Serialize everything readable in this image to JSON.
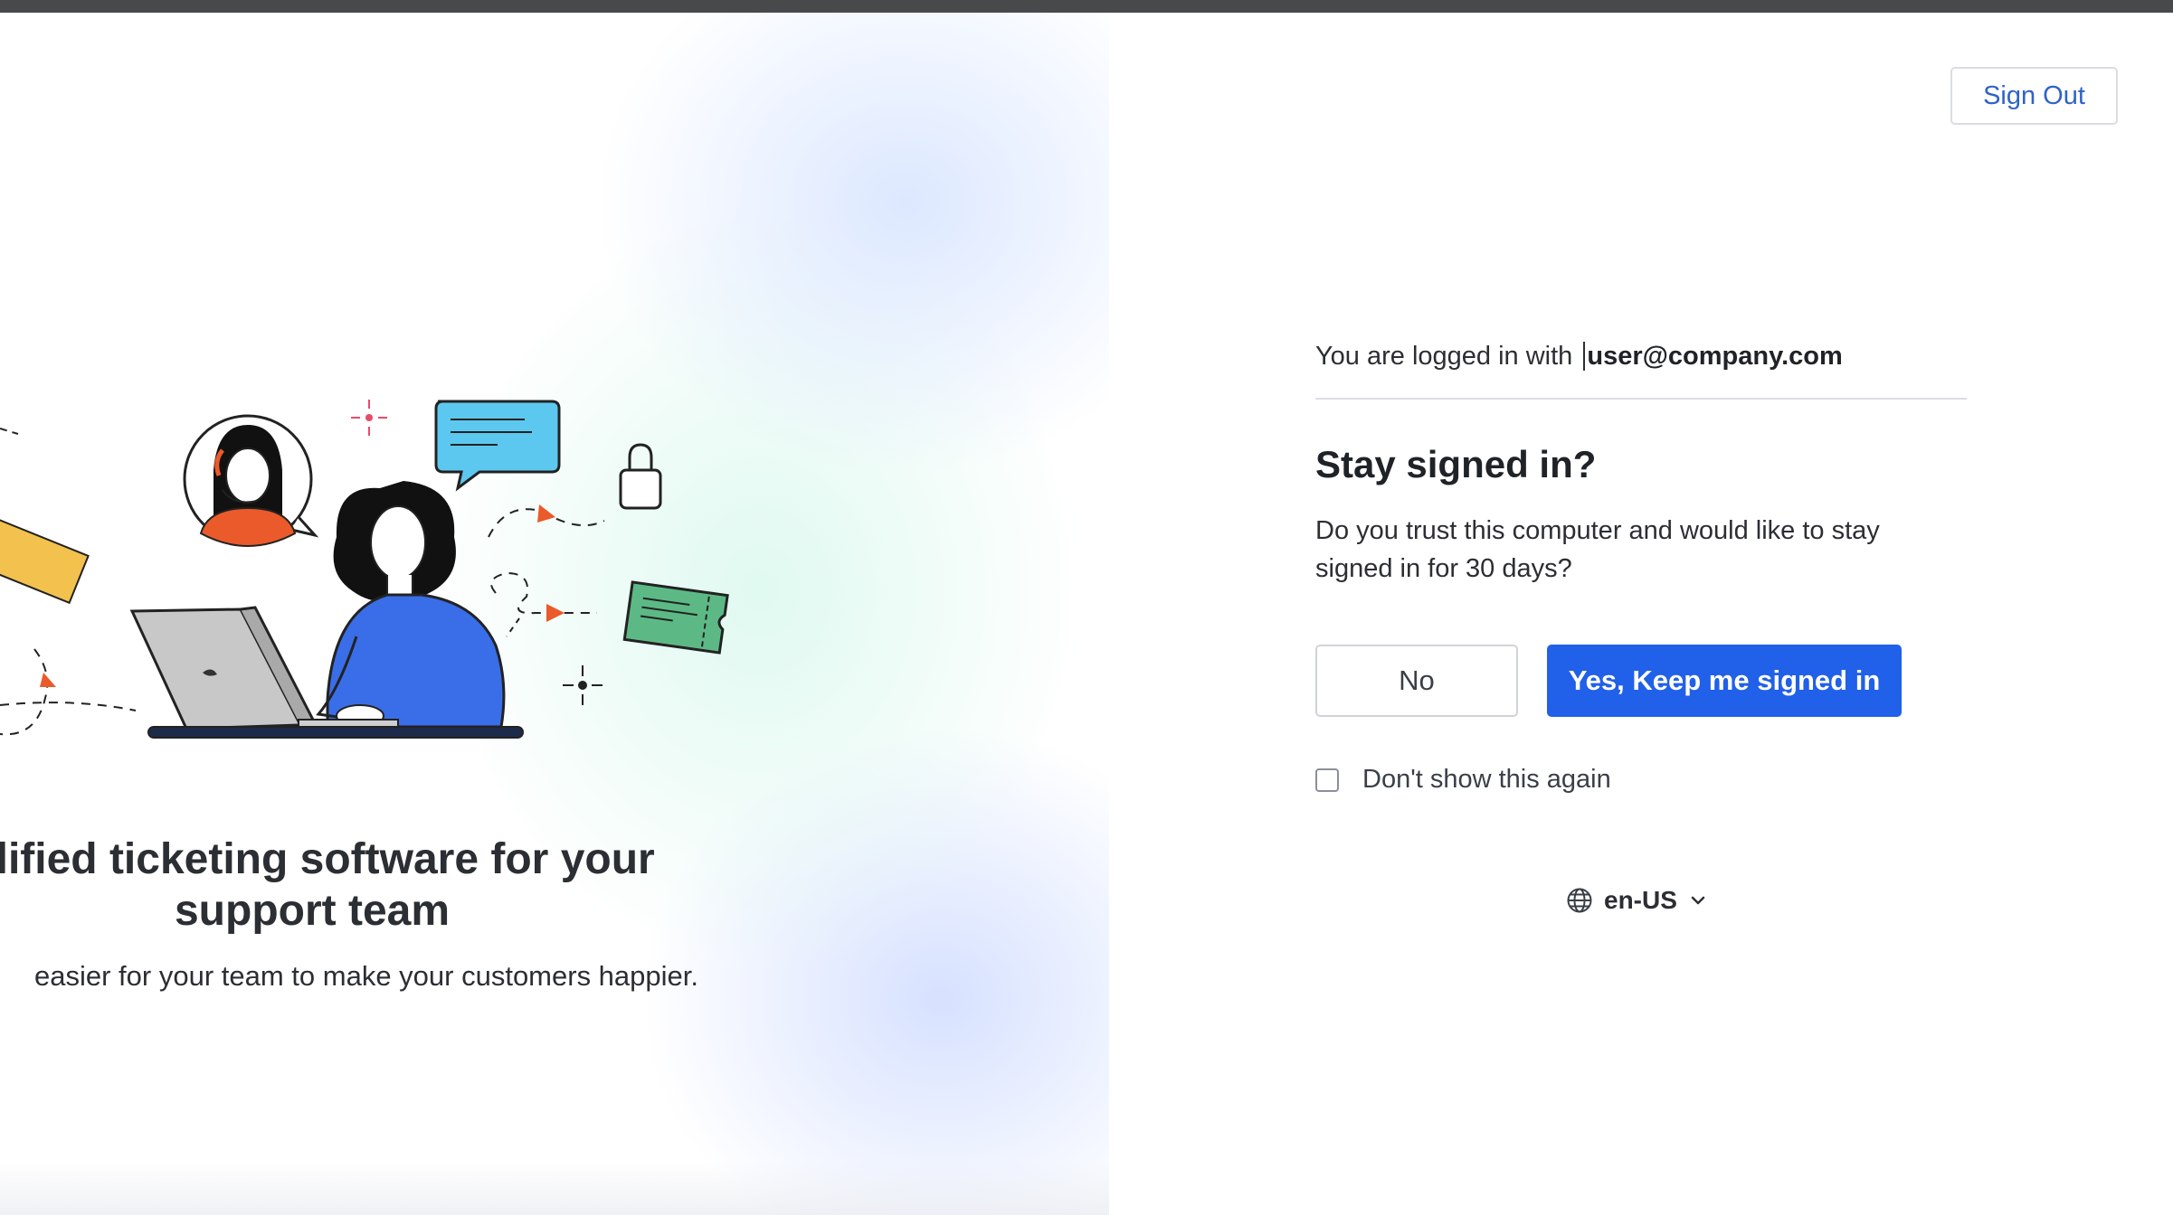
{
  "hero": {
    "heading_line1": "plified ticketing software for your",
    "heading_line2": "support team",
    "subtext": "easier for your team to make your customers happier."
  },
  "header": {
    "sign_out_label": "Sign Out"
  },
  "login": {
    "logged_in_prefix": "You are logged in with",
    "email": "user@company.com",
    "title": "Stay signed in?",
    "description": "Do you trust this computer and would like to stay signed in for 30 days?",
    "no_label": "No",
    "yes_label": "Yes, Keep me signed in",
    "dont_show_label": "Don't show this again",
    "dont_show_checked": false
  },
  "language": {
    "selected": "en-US",
    "icon": "globe-icon"
  },
  "colors": {
    "primary": "#2160e8",
    "link": "#2e63c9",
    "illustration_speech_bubble": "#5cc8f0",
    "illustration_ticket": "#5cb985",
    "illustration_shirt": "#3a6ee8",
    "illustration_accent": "#ea5a2a",
    "illustration_yellow": "#f2c14e"
  }
}
